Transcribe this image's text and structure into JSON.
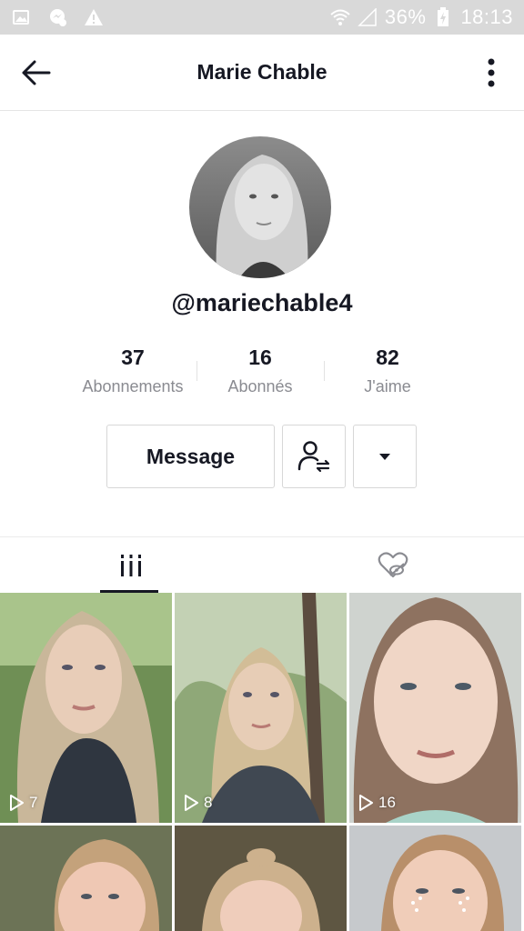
{
  "status_bar": {
    "battery": "36%",
    "time": "18:13",
    "icons": [
      "gallery-icon",
      "messenger-icon",
      "warning-icon",
      "wifi-icon",
      "signal-icon",
      "battery-charging-icon"
    ]
  },
  "header": {
    "title": "Marie Chable",
    "back_icon": "arrow-left-icon",
    "more_icon": "vertical-dots-icon"
  },
  "profile": {
    "username": "@mariechable4",
    "stats": [
      {
        "value": "37",
        "label": "Abonnements"
      },
      {
        "value": "16",
        "label": "Abonnés"
      },
      {
        "value": "82",
        "label": "J'aime"
      }
    ]
  },
  "actions": {
    "message_label": "Message",
    "follow_icon": "user-swap-icon",
    "dropdown_icon": "caret-down-icon"
  },
  "tabs": [
    {
      "name": "videos",
      "icon": "grid-bars-icon",
      "active": true
    },
    {
      "name": "liked",
      "icon": "heart-hidden-icon",
      "active": false
    }
  ],
  "videos": [
    {
      "views": "7"
    },
    {
      "views": "8"
    },
    {
      "views": "16"
    },
    {
      "views": ""
    },
    {
      "views": ""
    },
    {
      "views": ""
    }
  ]
}
